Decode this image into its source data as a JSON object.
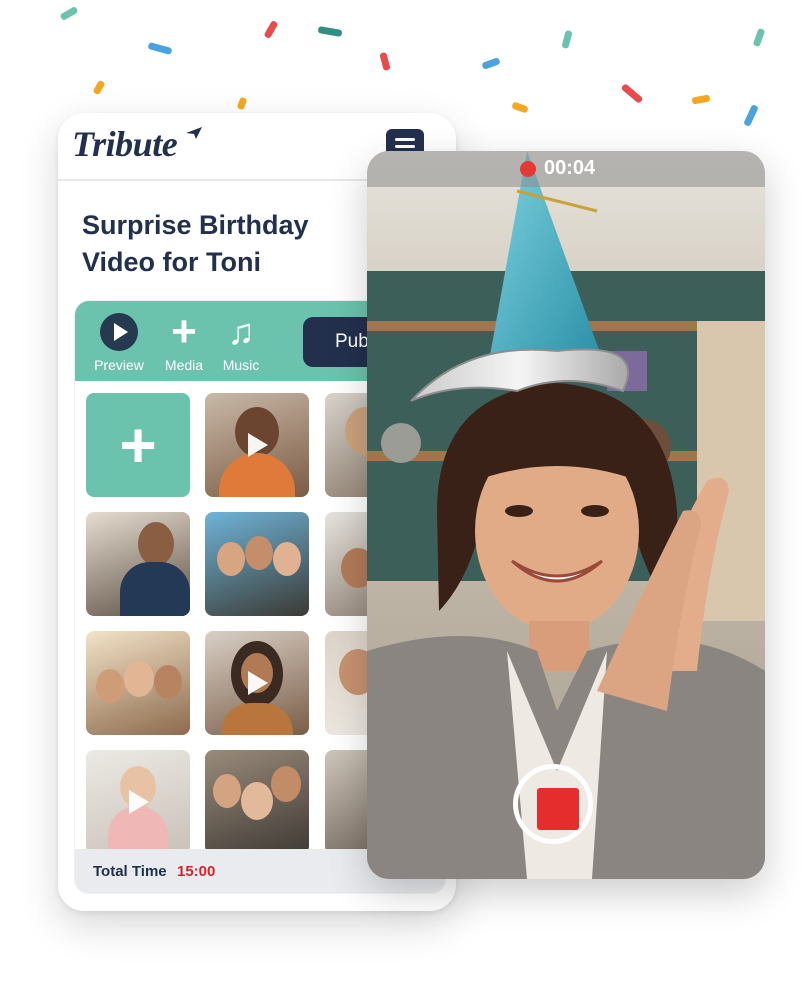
{
  "app": {
    "brand": "Tribute",
    "menu_icon": "hamburger-menu-icon"
  },
  "page": {
    "title_line1": "Surprise Birthday",
    "title_line2": "Video for Toni"
  },
  "toolbar": {
    "preview_label": "Preview",
    "media_label": "Media",
    "music_label": "Music",
    "publish_label": "Pub",
    "icons": {
      "preview": "play-circle-icon",
      "media": "plus-icon",
      "music": "music-note-icon"
    }
  },
  "grid": {
    "add_tile_icon": "plus-icon",
    "tiles": [
      {
        "kind": "add"
      },
      {
        "kind": "video",
        "has_play": true
      },
      {
        "kind": "video",
        "has_play": false
      },
      {
        "kind": "photo",
        "has_play": false
      },
      {
        "kind": "photo",
        "has_play": false
      },
      {
        "kind": "photo",
        "has_play": false
      },
      {
        "kind": "photo",
        "has_play": false
      },
      {
        "kind": "video",
        "has_play": true
      },
      {
        "kind": "photo",
        "has_play": false
      },
      {
        "kind": "video",
        "has_play": true
      },
      {
        "kind": "photo",
        "has_play": false
      },
      {
        "kind": "photo",
        "has_play": false
      }
    ]
  },
  "footer": {
    "total_label": "Total Time",
    "total_value": "15:00"
  },
  "recorder": {
    "timer": "00:04",
    "record_icon": "stop-record-icon"
  },
  "colors": {
    "accent": "#6cc3ad",
    "navy": "#23304d",
    "record_red": "#e53935",
    "total_red": "#d8232a"
  }
}
